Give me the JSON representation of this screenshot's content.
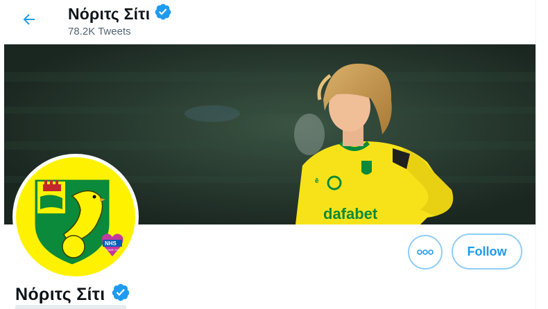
{
  "header": {
    "back_icon": "arrow-left-icon",
    "name": "Νόριτς Σίτι",
    "verified_icon": "verified-badge-icon",
    "tweet_count": "78.2K Tweets"
  },
  "banner": {
    "sponsor_text": "dafabet"
  },
  "avatar": {
    "badge_text": "NHS",
    "badge_subtext": "THANK YOU"
  },
  "actions": {
    "more_icon": "more-options-icon",
    "follow_label": "Follow"
  },
  "profile": {
    "name": "Νόριτς Σίτι",
    "verified_icon": "verified-badge-icon"
  },
  "colors": {
    "accent": "#1d9bf0",
    "button_border": "#8ecdf8",
    "club_yellow": "#fff200",
    "club_green": "#00a650"
  }
}
